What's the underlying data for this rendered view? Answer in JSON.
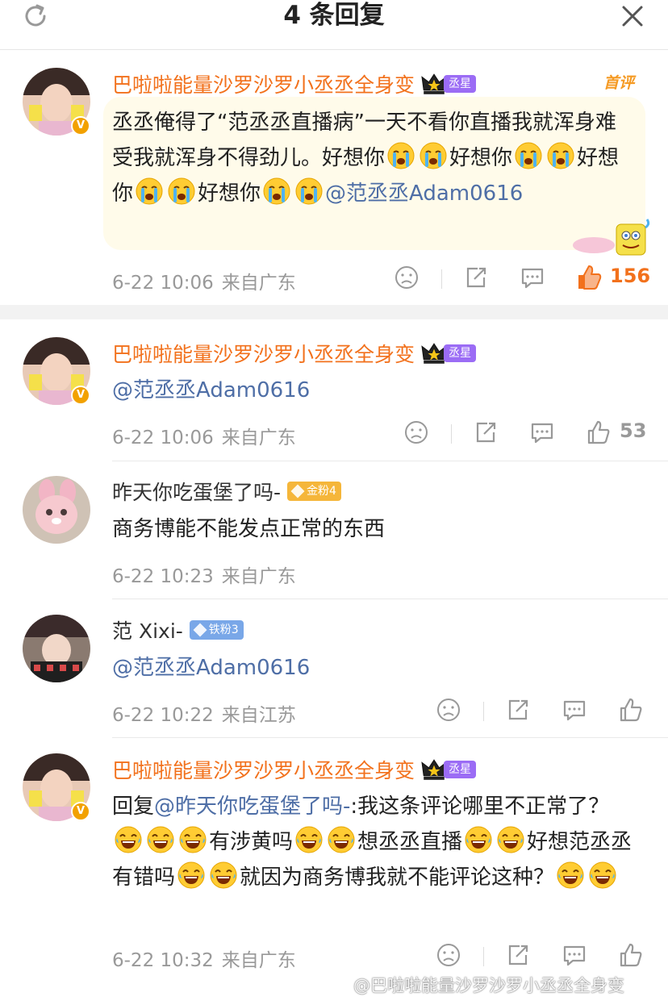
{
  "header": {
    "title": "4 条回复"
  },
  "comments": [
    {
      "username": "巴啦啦能量沙罗沙罗小丞丞全身变",
      "badge": "丞星",
      "first_tag": "首评",
      "text_parts": [
        "丞丞俺得了“范丞丞直播病”一天不看你直播我就浑身难受我就浑身不得劲儿。好想你",
        "好想你",
        "好想你",
        "好想你"
      ],
      "mention": "@范丞丞Adam0616",
      "date": "6-22 10:06",
      "location": "来自广东",
      "likes": "156"
    },
    {
      "username": "巴啦啦能量沙罗沙罗小丞丞全身变",
      "badge": "丞星",
      "mention": "@范丞丞Adam0616",
      "date": "6-22 10:06",
      "location": "来自广东",
      "likes": "53"
    },
    {
      "username": "昨天你吃蛋堡了吗-",
      "badge": "金粉4",
      "text": "商务博能不能发点正常的东西",
      "date": "6-22 10:23",
      "location": "来自广东"
    },
    {
      "username": "范 Xixi-",
      "badge": "铁粉3",
      "mention": "@范丞丞Adam0616",
      "date": "6-22 10:22",
      "location": "来自江苏"
    },
    {
      "username": "巴啦啦能量沙罗沙罗小丞丞全身变",
      "badge": "丞星",
      "reply_prefix": "回复",
      "reply_to": "@昨天你吃蛋堡了吗-",
      "text_parts": [
        ":我这条评论哪里不正常了？",
        "有涉黄吗",
        "想丞丞直播",
        "好想范丞丞有错吗",
        "就因为商务博我就不能评论这种？"
      ],
      "date": "6-22 10:32",
      "location": "来自广东"
    }
  ],
  "watermark": "@巴啦啦能量沙罗沙罗小丞丞全身变",
  "icons": {
    "refresh": "refresh-icon",
    "close": "close-icon",
    "dislike": "frown-icon",
    "share": "share-icon",
    "comment": "comment-icon",
    "like": "thumbs-up-icon",
    "cry": "crying-emoji-icon",
    "laugh": "laughing-emoji-icon"
  },
  "colors": {
    "username_vip": "#f2711c",
    "link": "#4e6ea6",
    "like_active": "#f2711c",
    "meta": "#999999"
  }
}
